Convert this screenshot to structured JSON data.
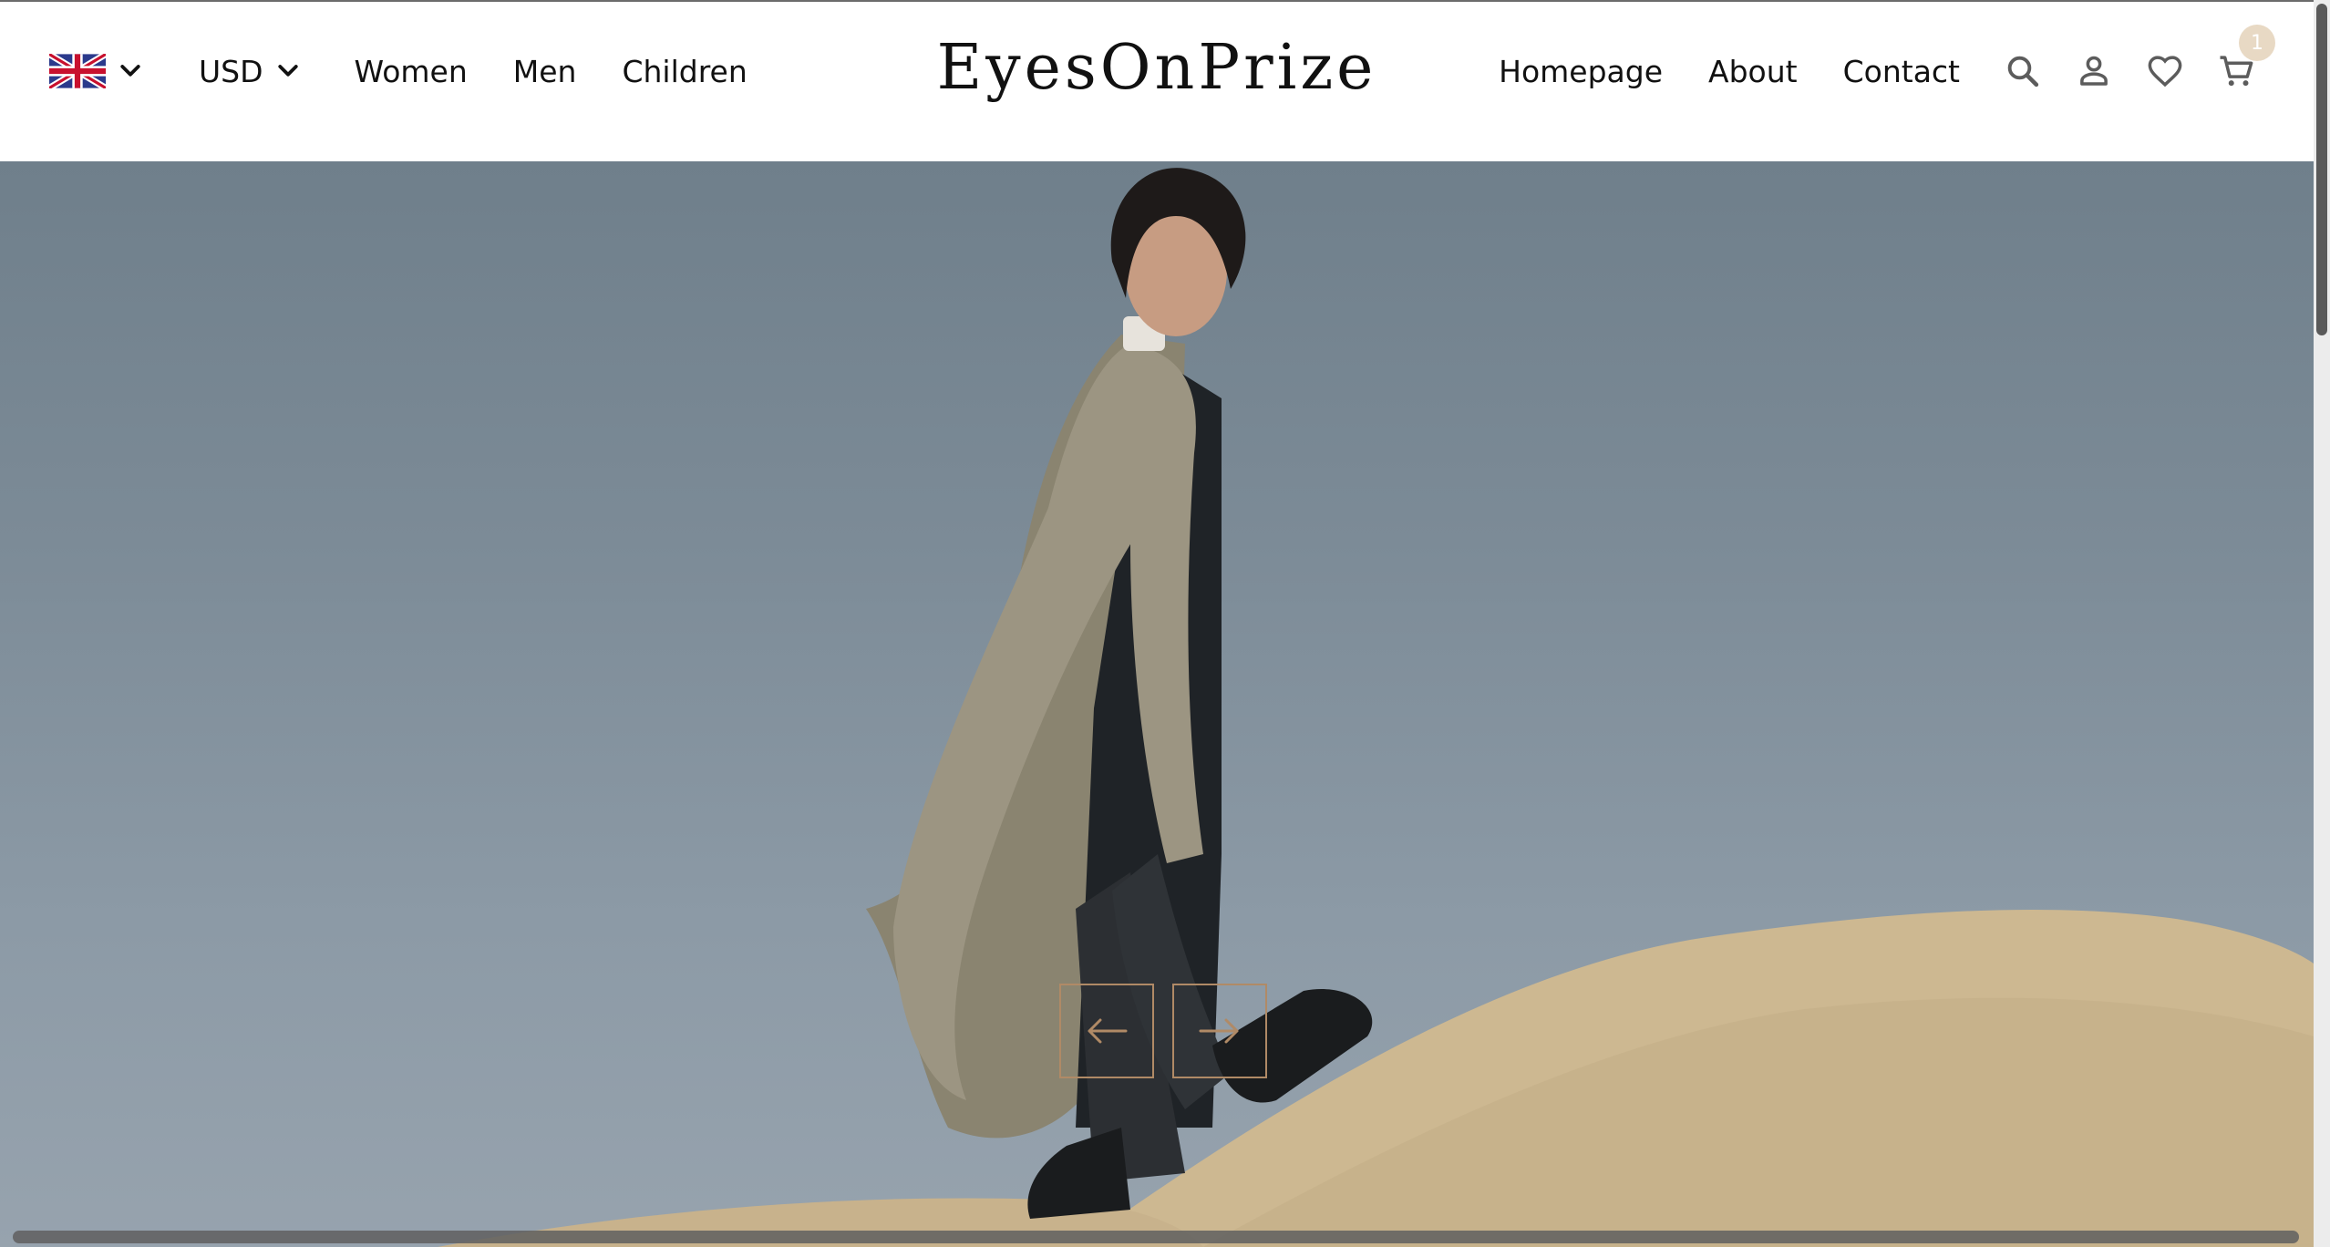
{
  "header": {
    "language": {
      "icon": "uk-flag-icon",
      "selected": "en-GB"
    },
    "currency": {
      "label": "USD"
    },
    "categories": [
      {
        "label": "Women"
      },
      {
        "label": "Men"
      },
      {
        "label": "Children"
      }
    ],
    "logo": "EyesOnPrize",
    "pages": [
      {
        "label": "Homepage"
      },
      {
        "label": "About"
      },
      {
        "label": "Contact"
      }
    ],
    "icons": {
      "search": "search-icon",
      "account": "person-icon",
      "wishlist": "heart-icon",
      "cart": "cart-icon"
    },
    "cart_count": "1"
  },
  "hero": {
    "image": "fashion-model-beige-trench-coat-on-sand",
    "prev": "arrow-left-icon",
    "next": "arrow-right-icon"
  },
  "colors": {
    "accent": "#b08a66",
    "badge": "#e8d9c4",
    "sky": "#7c8b97",
    "sand": "#cdb891"
  }
}
